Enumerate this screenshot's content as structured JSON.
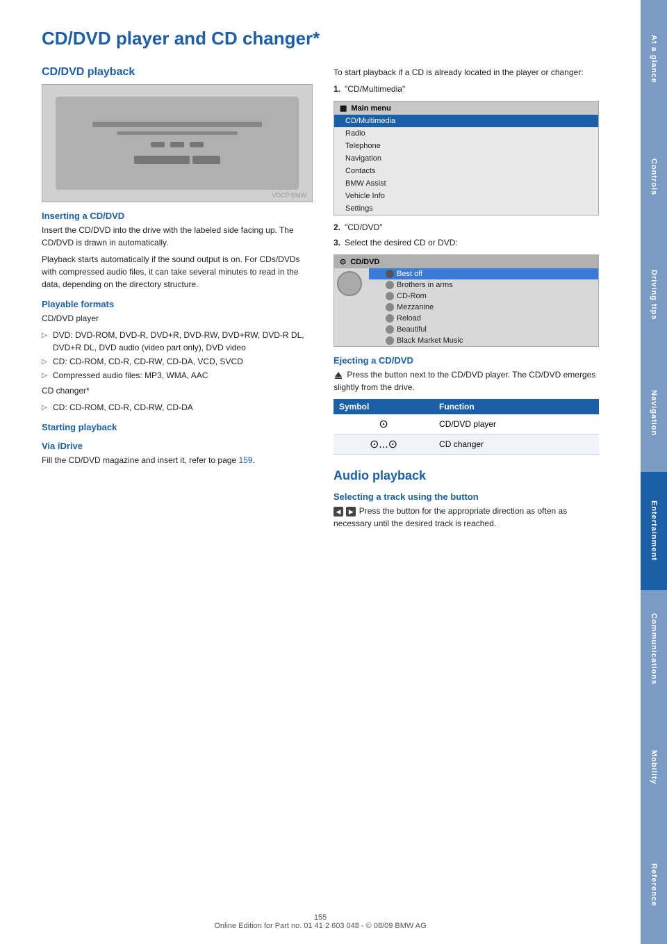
{
  "page": {
    "title": "CD/DVD player and CD changer*",
    "page_number": "155",
    "footer_text": "Online Edition for Part no. 01 41 2 603 048 - © 08/09 BMW AG"
  },
  "side_tabs": [
    {
      "label": "At a glance",
      "active": false
    },
    {
      "label": "Controls",
      "active": false
    },
    {
      "label": "Driving tips",
      "active": false
    },
    {
      "label": "Navigation",
      "active": false
    },
    {
      "label": "Entertainment",
      "active": true
    },
    {
      "label": "Communications",
      "active": false
    },
    {
      "label": "Mobility",
      "active": false
    },
    {
      "label": "Reference",
      "active": false
    }
  ],
  "left_col": {
    "section1_heading": "CD/DVD playback",
    "inserting_heading": "Inserting a CD/DVD",
    "inserting_text1": "Insert the CD/DVD into the drive with the labeled side facing up. The CD/DVD is drawn in automatically.",
    "inserting_text2": "Playback starts automatically if the sound output is on. For CDs/DVDs with compressed audio files, it can take several minutes to read in the data, depending on the directory structure.",
    "formats_heading": "Playable formats",
    "formats_label1": "CD/DVD player",
    "formats_bullets_dvd": "DVD: DVD-ROM, DVD-R, DVD+R, DVD-RW, DVD+RW, DVD-R DL, DVD+R DL, DVD audio (video part only), DVD video",
    "formats_bullets_cd": "CD: CD-ROM, CD-R, CD-RW, CD-DA, VCD, SVCD",
    "formats_bullets_compressed": "Compressed audio files: MP3, WMA, AAC",
    "formats_label2": "CD changer*",
    "formats_bullets_changer": "CD: CD-ROM, CD-R, CD-RW, CD-DA",
    "starting_heading": "Starting playback",
    "via_idrive_heading": "Via iDrive",
    "via_idrive_text": "Fill the CD/DVD magazine and insert it, refer to page",
    "via_idrive_page": "159",
    "via_idrive_period": "."
  },
  "right_col": {
    "intro_text": "To start playback if a CD is already located in the player or changer:",
    "step1_label": "1.",
    "step1_text": "\"CD/Multimedia\"",
    "step2_label": "2.",
    "step2_text": "\"CD/DVD\"",
    "step3_label": "3.",
    "step3_text": "Select the desired CD or DVD:",
    "ejecting_heading": "Ejecting a CD/DVD",
    "ejecting_text": "Press the button next to the CD/DVD player. The CD/DVD emerges slightly from the drive.",
    "symbol_table": {
      "col1": "Symbol",
      "col2": "Function",
      "rows": [
        {
          "symbol": "⊙",
          "function": "CD/DVD player"
        },
        {
          "symbol": "⊙...⊙",
          "function": "CD changer"
        }
      ]
    },
    "audio_playback_heading": "Audio playback",
    "selecting_track_heading": "Selecting a track using the button",
    "selecting_track_text": "Press the button for the appropriate direction as often as necessary until the desired track is reached."
  },
  "menu": {
    "title": "Main menu",
    "items": [
      {
        "label": "CD/Multimedia",
        "highlighted": true
      },
      {
        "label": "Radio",
        "highlighted": false
      },
      {
        "label": "Telephone",
        "highlighted": false
      },
      {
        "label": "Navigation",
        "highlighted": false
      },
      {
        "label": "Contacts",
        "highlighted": false
      },
      {
        "label": "BMW Assist",
        "highlighted": false
      },
      {
        "label": "Vehicle Info",
        "highlighted": false
      },
      {
        "label": "Settings",
        "highlighted": false
      }
    ]
  },
  "cd_menu": {
    "title": "CD/DVD",
    "items": [
      {
        "label": "Best off",
        "highlighted": true
      },
      {
        "label": "Brothers in arms",
        "highlighted": false
      },
      {
        "label": "CD-Rom",
        "highlighted": false
      },
      {
        "label": "Mezzanine",
        "highlighted": false
      },
      {
        "label": "Reload",
        "highlighted": false
      },
      {
        "label": "Beautiful",
        "highlighted": false
      },
      {
        "label": "Black Market Music",
        "highlighted": false
      }
    ]
  }
}
